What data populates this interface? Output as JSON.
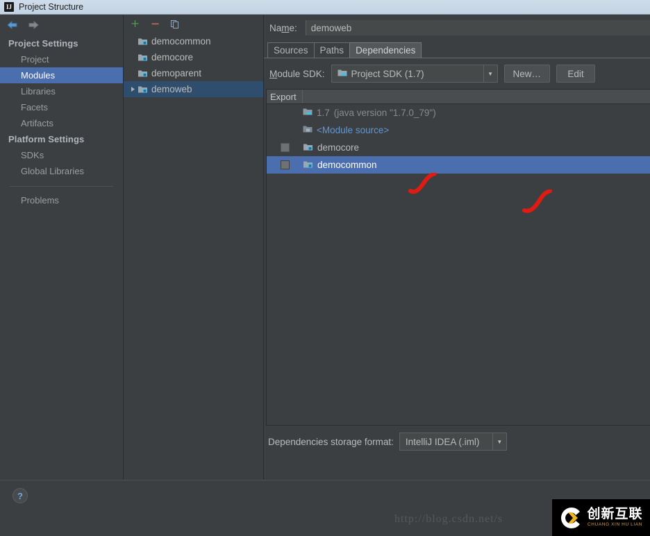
{
  "window": {
    "title": "Project Structure",
    "app_icon": "IJ"
  },
  "nav": {
    "back_icon": "arrow-left-icon",
    "forward_icon": "arrow-right-icon"
  },
  "sidebar": {
    "groups": [
      {
        "header": "Project Settings",
        "items": [
          {
            "label": "Project",
            "selected": false
          },
          {
            "label": "Modules",
            "selected": true
          },
          {
            "label": "Libraries",
            "selected": false
          },
          {
            "label": "Facets",
            "selected": false
          },
          {
            "label": "Artifacts",
            "selected": false
          }
        ]
      },
      {
        "header": "Platform Settings",
        "items": [
          {
            "label": "SDKs",
            "selected": false
          },
          {
            "label": "Global Libraries",
            "selected": false
          }
        ]
      }
    ],
    "problems": {
      "label": "Problems"
    }
  },
  "module_list": {
    "toolbar": {
      "add_label": "+",
      "remove_label": "−",
      "copy_label": "copy-icon"
    },
    "items": [
      {
        "label": "democommon",
        "selected": false,
        "expandable": false
      },
      {
        "label": "democore",
        "selected": false,
        "expandable": false
      },
      {
        "label": "demoparent",
        "selected": false,
        "expandable": false
      },
      {
        "label": "demoweb",
        "selected": true,
        "expandable": true
      }
    ]
  },
  "right_panel": {
    "name_field": {
      "label": "Name:",
      "label_underline": "m",
      "value": "demoweb"
    },
    "tabs": [
      {
        "label": "Sources",
        "active": false
      },
      {
        "label": "Paths",
        "active": false
      },
      {
        "label": "Dependencies",
        "active": true
      }
    ],
    "sdk_row": {
      "label": "Module SDK:",
      "label_underline": "M",
      "value": "Project SDK (1.7)",
      "new_button": "New…",
      "edit_button": "Edit"
    },
    "dependencies_table": {
      "columns": [
        {
          "label": "Export"
        },
        {
          "label": ""
        }
      ],
      "rows": [
        {
          "checkbox": "none",
          "icon": "sdk-icon",
          "name": "1.7",
          "detail": "(java version \"1.7.0_79\")",
          "style": "dim",
          "selected": false
        },
        {
          "checkbox": "none",
          "icon": "module-source-icon",
          "name": "<Module source>",
          "detail": "",
          "style": "link",
          "selected": false
        },
        {
          "checkbox": "unchecked",
          "icon": "module-icon",
          "name": "democore",
          "detail": "",
          "style": "normal",
          "selected": false
        },
        {
          "checkbox": "unchecked",
          "icon": "module-icon",
          "name": "democommon",
          "detail": "",
          "style": "normal",
          "selected": true
        }
      ]
    },
    "storage_row": {
      "label": "Dependencies storage format:",
      "value": "IntelliJ IDEA (.iml)"
    }
  },
  "footer": {
    "help_button": "?"
  },
  "watermark": {
    "url_text": "http://blog.csdn.net/s",
    "logo_cn": "创新互联",
    "logo_pinyin": "CHUANG XIN HU LIAN"
  },
  "colors": {
    "background": "#3c3f41",
    "selection_blue": "#4b6eaf",
    "tree_selection": "#2f4d6d",
    "link": "#5f97d8",
    "annotation_red": "#e01b12",
    "titlebar": "#c7d6e5"
  }
}
